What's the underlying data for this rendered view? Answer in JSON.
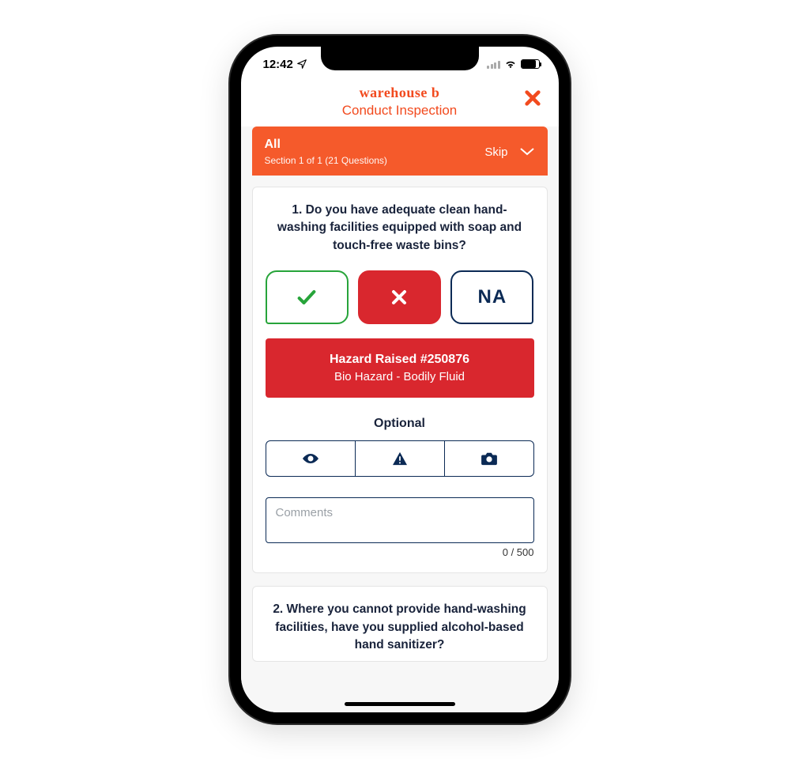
{
  "status": {
    "time": "12:42"
  },
  "header": {
    "title": "warehouse b",
    "subtitle": "Conduct Inspection"
  },
  "section": {
    "title": "All",
    "subtitle": "Section 1 of 1 (21 Questions)",
    "skip": "Skip"
  },
  "q1": {
    "text": "1. Do you have adequate clean hand-washing facilities equipped with soap and touch-free waste bins?",
    "na_label": "NA",
    "hazard_title": "Hazard Raised #250876",
    "hazard_sub": "Bio Hazard - Bodily Fluid",
    "optional_label": "Optional",
    "comments_placeholder": "Comments",
    "counter": "0 / 500"
  },
  "q2": {
    "text": "2. Where you cannot provide hand-washing facilities, have you supplied alcohol-based hand sanitizer?"
  }
}
